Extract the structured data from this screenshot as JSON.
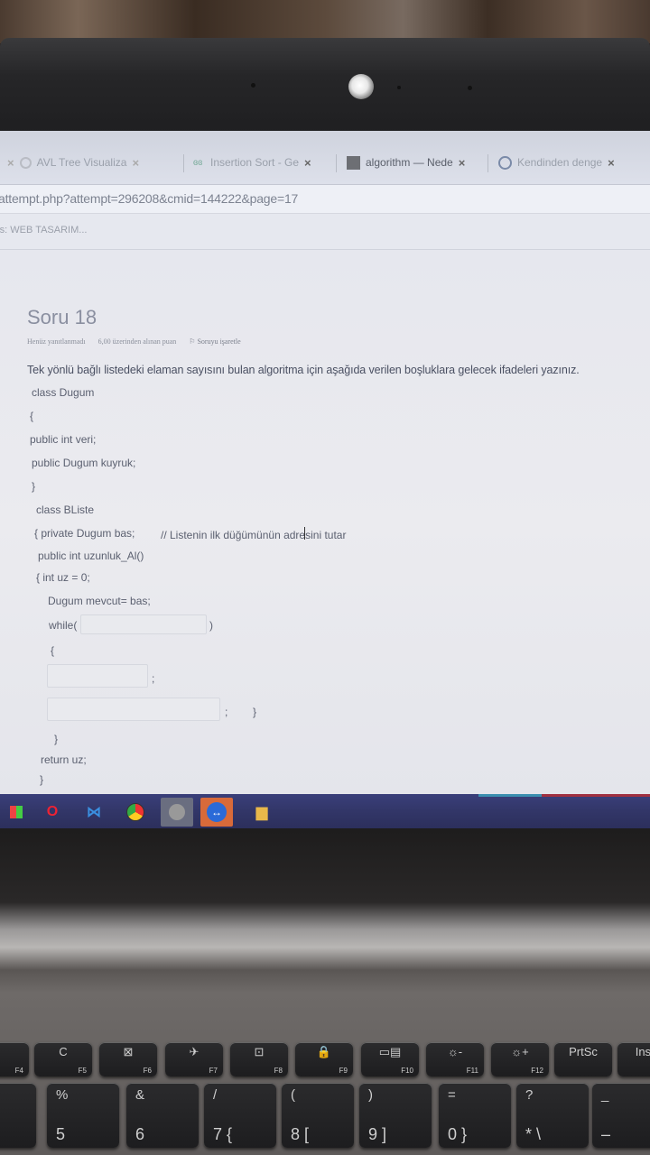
{
  "browser": {
    "tabs": [
      {
        "label": "AVL Tree Visualiza",
        "close": "×"
      },
      {
        "label": "Insertion Sort - Ge",
        "close": "×"
      },
      {
        "label": "algorithm — Nede",
        "close": "×"
      },
      {
        "label": "Kendinden denge",
        "close": "×"
      }
    ],
    "address": "attempt.php?attempt=296208&cmid=144222&page=17",
    "bookmark": "rs: WEB TASARIM..."
  },
  "quiz": {
    "title": "Soru 18",
    "status": "Henüz yanıtlanmadı",
    "points": "6,00 üzerinden alınan puan",
    "flag_label": "Soruyu işaretle",
    "question": "Tek yönlü bağlı listedeki elaman sayısını bulan algoritma için aşağıda verilen boşluklara gelecek ifadeleri yazınız.",
    "code": {
      "l1": "class Dugum",
      "l2": "{",
      "l3": "public int veri;",
      "l4": "public Dugum kuyruk;",
      "l5": "}",
      "l6": "class BListe",
      "l7": "{ private Dugum bas;",
      "l7c": "// Listenin ilk düğümünün adresini tutar",
      "l8": "public int uzunluk_Al()",
      "l9": "{  int uz = 0;",
      "l10": "Dugum  mevcut= bas;",
      "l11a": "while(",
      "l11b": ")",
      "l12": "{",
      "l13": ";",
      "l14a": ";",
      "l14b": "}",
      "l15": "}",
      "l16": "return uz;",
      "l17": "}"
    }
  },
  "keyboard": {
    "fkeys": [
      {
        "sub": "F4",
        "top": ""
      },
      {
        "sub": "F5",
        "top": "C"
      },
      {
        "sub": "F6",
        "top": "⊠"
      },
      {
        "sub": "F7",
        "top": "✈"
      },
      {
        "sub": "F8",
        "top": "⊡"
      },
      {
        "sub": "F9",
        "top": "🔒"
      },
      {
        "sub": "F10",
        "top": "▭▤"
      },
      {
        "sub": "F11",
        "top": "☼-"
      },
      {
        "sub": "F12",
        "top": "☼+"
      },
      {
        "sub": "",
        "top": "PrtSc"
      },
      {
        "sub": "",
        "top": "Inse"
      }
    ],
    "numkeys": [
      {
        "up": "",
        "big": "$"
      },
      {
        "up": "%",
        "big": "5"
      },
      {
        "up": "&",
        "big": "6"
      },
      {
        "up": "/",
        "big": "7  {"
      },
      {
        "up": "(",
        "big": "8  ["
      },
      {
        "up": ")",
        "big": "9  ]"
      },
      {
        "up": "=",
        "big": "0  }"
      },
      {
        "up": "?",
        "big": "*  \\"
      },
      {
        "up": "_",
        "big": "–"
      }
    ]
  }
}
